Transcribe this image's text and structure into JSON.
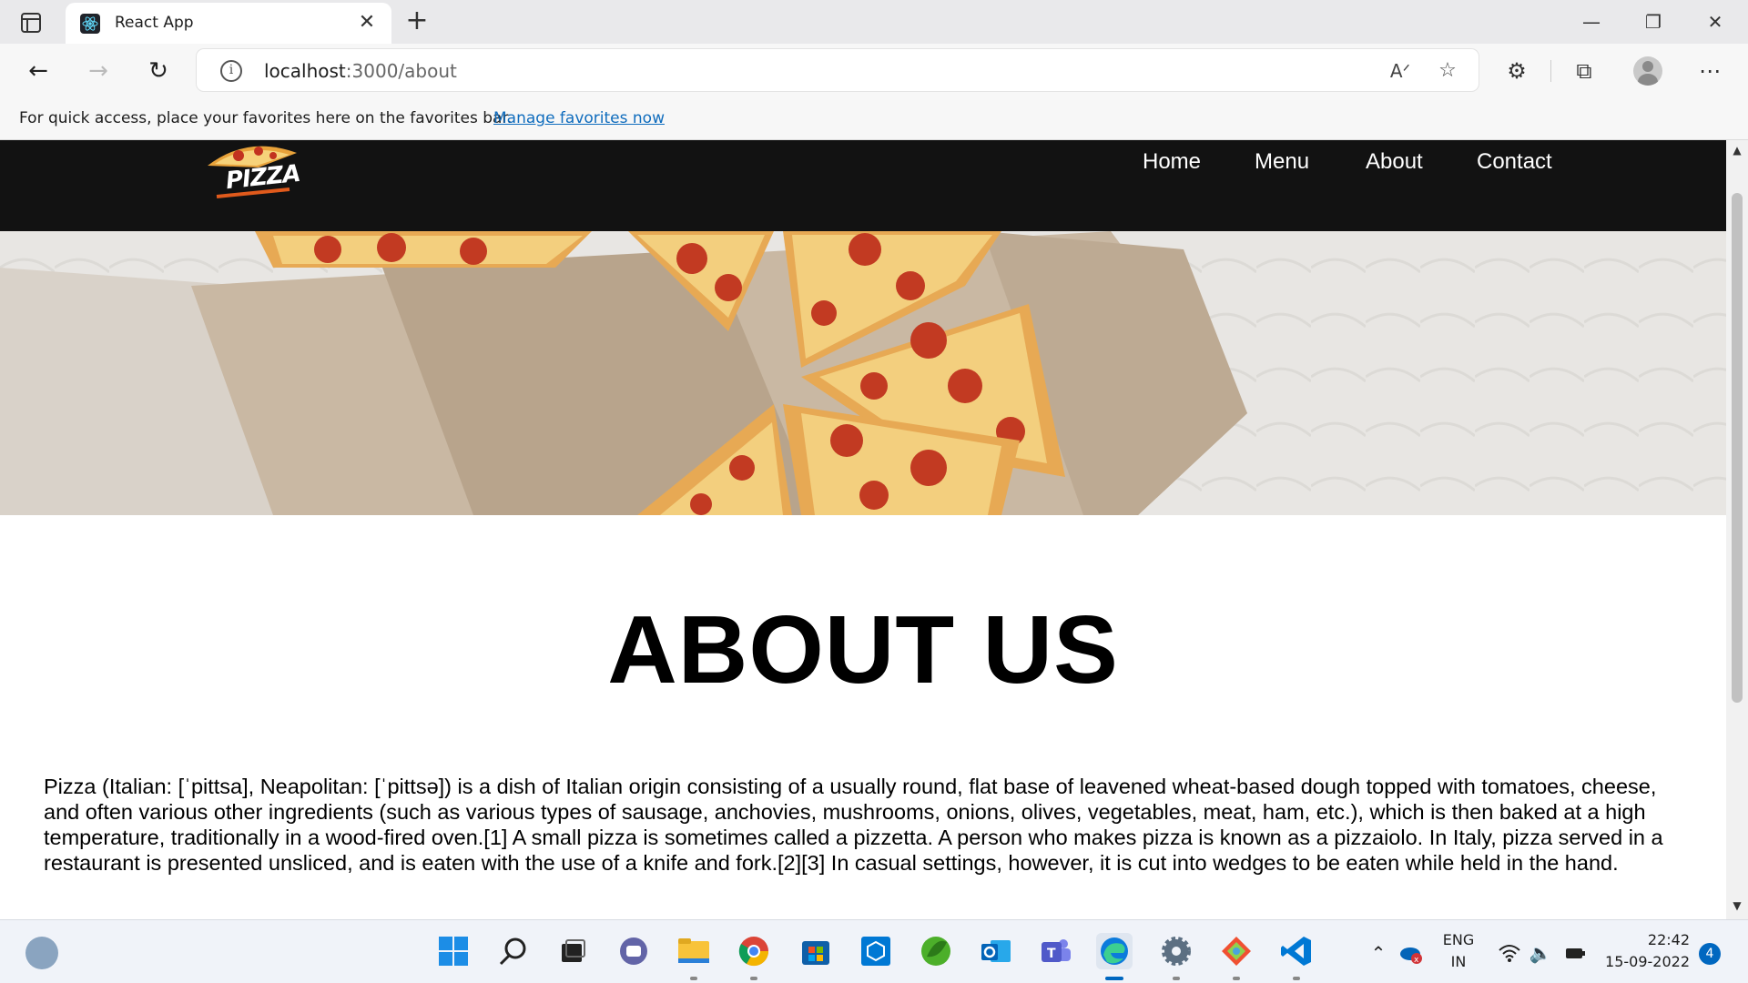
{
  "browser": {
    "tab_title": "React App",
    "url_host": "localhost",
    "url_path": ":3000/about",
    "favorites_prompt": "For quick access, place your favorites here on the favorites bar.",
    "favorites_link": "Manage favorites now"
  },
  "site": {
    "logo_text": "PIZZA",
    "nav": [
      "Home",
      "Menu",
      "About",
      "Contact"
    ]
  },
  "about": {
    "title": "ABOUT US",
    "body": "Pizza (Italian: [ˈpittsa], Neapolitan: [ˈpittsə]) is a dish of Italian origin consisting of a usually round, flat base of leavened wheat-based dough topped with tomatoes, cheese, and often various other ingredients (such as various types of sausage, anchovies, mushrooms, onions, olives, vegetables, meat, ham, etc.), which is then baked at a high temperature, traditionally in a wood-fired oven.[1] A small pizza is sometimes called a pizzetta. A person who makes pizza is known as a pizzaiolo. In Italy, pizza served in a restaurant is presented unsliced, and is eaten with the use of a knife and fork.[2][3] In casual settings, however, it is cut into wedges to be eaten while held in the hand."
  },
  "taskbar": {
    "language": "ENG",
    "region": "IN",
    "time": "22:42",
    "date": "15-09-2022",
    "notifications": "4"
  },
  "colors": {
    "nav_bg": "#121212",
    "link": "#0f6cbd",
    "accent": "#0067c0"
  }
}
